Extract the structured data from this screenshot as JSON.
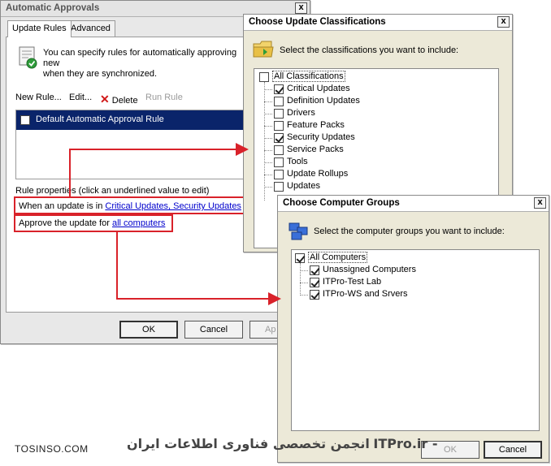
{
  "main_window": {
    "title": "Automatic Approvals",
    "close_glyph": "x",
    "tabs": [
      {
        "label": "Update Rules"
      },
      {
        "label": "Advanced"
      }
    ],
    "description_line1": "You can specify rules for automatically approving new",
    "description_line2": "when they are synchronized.",
    "toolbar": {
      "new_rule": "New Rule...",
      "edit": "Edit...",
      "delete": "Delete",
      "run_rule": "Run Rule"
    },
    "rules": [
      {
        "label": "Default Automatic Approval Rule",
        "checked": false
      }
    ],
    "rule_properties_label": "Rule properties (click an underlined value to edit)",
    "condition_prefix": "When an update is in",
    "condition_link": "Critical Updates, Security Updates",
    "approve_prefix": "Approve the update for",
    "approve_link": "all computers",
    "buttons": {
      "ok": "OK",
      "cancel": "Cancel",
      "apply": "Ap"
    }
  },
  "classification_window": {
    "title": "Choose Update Classifications",
    "close_glyph": "x",
    "instruction": "Select the classifications you want to include:",
    "root": {
      "label": "All Classifications",
      "checked": false
    },
    "items": [
      {
        "label": "Critical Updates",
        "checked": true
      },
      {
        "label": "Definition Updates",
        "checked": false
      },
      {
        "label": "Drivers",
        "checked": false
      },
      {
        "label": "Feature Packs",
        "checked": false
      },
      {
        "label": "Security Updates",
        "checked": true
      },
      {
        "label": "Service Packs",
        "checked": false
      },
      {
        "label": "Tools",
        "checked": false
      },
      {
        "label": "Update Rollups",
        "checked": false
      },
      {
        "label": "Updates",
        "checked": false
      }
    ]
  },
  "groups_window": {
    "title": "Choose Computer Groups",
    "close_glyph": "x",
    "instruction": "Select the computer groups you want to include:",
    "root": {
      "label": "All Computers",
      "checked": true
    },
    "items": [
      {
        "label": "Unassigned Computers",
        "checked": true
      },
      {
        "label": "ITPro-Test Lab",
        "checked": true
      },
      {
        "label": "ITPro-WS and Srvers",
        "checked": true
      }
    ],
    "buttons": {
      "ok": "OK",
      "cancel": "Cancel"
    }
  },
  "watermark": {
    "left": "TOSINSO.COM",
    "right_persian": "انجمن تخصصی فناوری اطلاعات ایران",
    "right_brand": "ITPro.ir -"
  },
  "colors": {
    "highlight": "#0a246a",
    "callout_red": "#d9222a",
    "link": "#0000cc"
  }
}
